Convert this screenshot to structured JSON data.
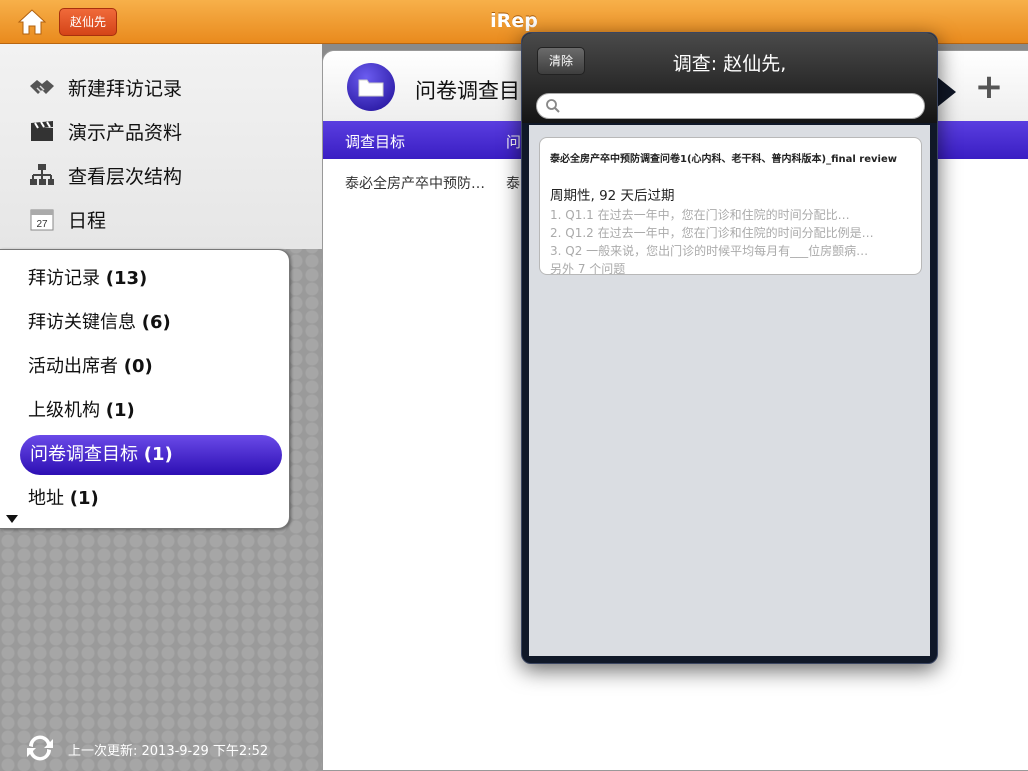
{
  "topbar": {
    "title": "iRep",
    "user": "赵仙先"
  },
  "menu": [
    {
      "label": "新建拜访记录",
      "icon": "handshake-icon"
    },
    {
      "label": "演示产品资料",
      "icon": "clapperboard-icon"
    },
    {
      "label": "查看层次结构",
      "icon": "hierarchy-icon"
    },
    {
      "label": "日程",
      "icon": "calendar-icon",
      "calendar_day": "27"
    }
  ],
  "related": [
    {
      "label": "拜访记录",
      "count": "(13)"
    },
    {
      "label": "拜访关键信息",
      "count": "(6)"
    },
    {
      "label": "活动出席者",
      "count": "(0)"
    },
    {
      "label": "上级机构",
      "count": "(1)"
    },
    {
      "label": "问卷调查目标",
      "count": "(1)",
      "active": true
    },
    {
      "label": "地址",
      "count": "(1)"
    }
  ],
  "footer": {
    "last_update": "上一次更新: 2013-9-29 下午2:52"
  },
  "main": {
    "title": "问卷调查目",
    "columns": [
      "调查目标",
      "问"
    ],
    "row": [
      "泰必全房产卒中预防…",
      "泰"
    ]
  },
  "popover": {
    "clear_label": "清除",
    "title": "调查: 赵仙先,",
    "search_placeholder": "",
    "card": {
      "title": "泰必全房产卒中预防调查问卷1(心内科、老干科、普内科版本)_final review",
      "expiry": "周期性, 92 天后过期",
      "questions": [
        "1. Q1.1 在过去一年中，您在门诊和住院的时间分配比…",
        "2. Q1.2 在过去一年中，您在门诊和住院的时间分配比例是…",
        "3. Q2 一般来说，您出门诊的时候平均每月有___位房颤病…"
      ],
      "more": "另外 7 个问题"
    }
  },
  "colors": {
    "accent": "#3a1ec3",
    "topbar": "#e98a1d"
  }
}
